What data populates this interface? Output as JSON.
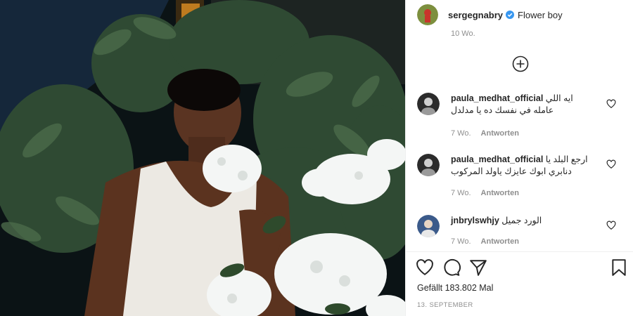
{
  "post": {
    "username": "sergegnabry",
    "caption": "Flower boy",
    "time_ago": "10 Wo.",
    "likes_text": "Gefällt 183.802 Mal",
    "date": "13. SEPTEMBER"
  },
  "comments": [
    {
      "username": "paula_medhat_official",
      "text_line1": "ايه اللي",
      "text_line2": "عامله في نفسك ده يا مدلدل",
      "time": "7 Wo.",
      "reply_label": "Antworten"
    },
    {
      "username": "paula_medhat_official",
      "text_line1": "ارجع البلد يا",
      "text_line2": "دنابري ابوك عايزك ياولد المركوب",
      "time": "7 Wo.",
      "reply_label": "Antworten"
    },
    {
      "username": "jnbrylswhjy",
      "text_line1": "الورد جميل",
      "text_line2": "",
      "time": "7 Wo.",
      "reply_label": "Antworten"
    }
  ],
  "icons": {
    "verified": "verified-badge-icon",
    "load_more": "plus-circle-icon",
    "like": "heart-icon",
    "comment": "comment-icon",
    "share": "paper-plane-icon",
    "save": "bookmark-icon"
  },
  "colors": {
    "verified_blue": "#3897f0",
    "muted_text": "#8e8e8e",
    "text": "#262626"
  }
}
